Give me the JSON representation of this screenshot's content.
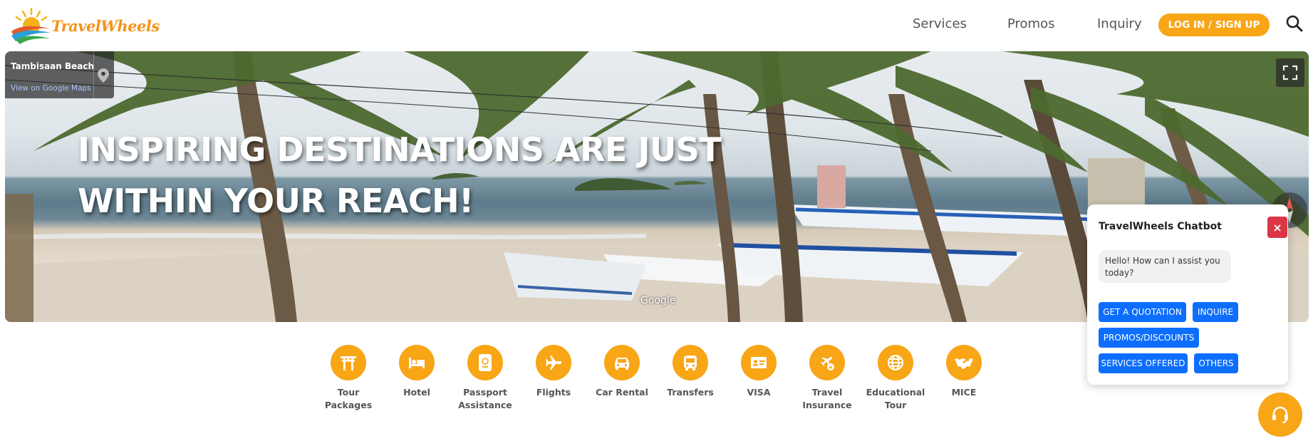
{
  "brand": {
    "name": "TravelWheels",
    "colors": {
      "accent": "#f8a516",
      "chat_button": "#0d6efd",
      "close": "#dc3545"
    }
  },
  "nav": {
    "links": [
      "Services",
      "Promos",
      "Inquiry"
    ],
    "login_label": "LOG IN / SIGN UP",
    "search_icon": "search-icon"
  },
  "hero": {
    "location": "Tambisaan Beach",
    "map_link": "View on Google Maps",
    "heading_line1": "INSPIRING DESTINATIONS ARE JUST",
    "heading_line2": "WITHIN YOUR REACH!",
    "watermark": "Google"
  },
  "services": [
    {
      "line1": "Tour",
      "line2": "Packages",
      "icon": "torii-gate-icon"
    },
    {
      "line1": "Hotel",
      "line2": "",
      "icon": "bed-icon"
    },
    {
      "line1": "Passport",
      "line2": "Assistance",
      "icon": "passport-icon"
    },
    {
      "line1": "Flights",
      "line2": "",
      "icon": "plane-icon"
    },
    {
      "line1": "Car Rental",
      "line2": "",
      "icon": "car-icon"
    },
    {
      "line1": "Transfers",
      "line2": "",
      "icon": "bus-icon"
    },
    {
      "line1": "VISA",
      "line2": "",
      "icon": "id-card-icon"
    },
    {
      "line1": "Travel",
      "line2": "Insurance",
      "icon": "plane-shield-icon"
    },
    {
      "line1": "Educational",
      "line2": "Tour",
      "icon": "globe-icon"
    },
    {
      "line1": "MICE",
      "line2": "",
      "icon": "handshake-icon"
    }
  ],
  "chatbot": {
    "title": "TravelWheels Chatbot",
    "close_label": "×",
    "greeting": "Hello! How can I assist you today?",
    "buttons": [
      "GET A QUOTATION",
      "INQUIRE",
      "PROMOS/DISCOUNTS",
      "SERVICES OFFERED",
      "OTHERS"
    ]
  },
  "support_icon": "headset-icon"
}
